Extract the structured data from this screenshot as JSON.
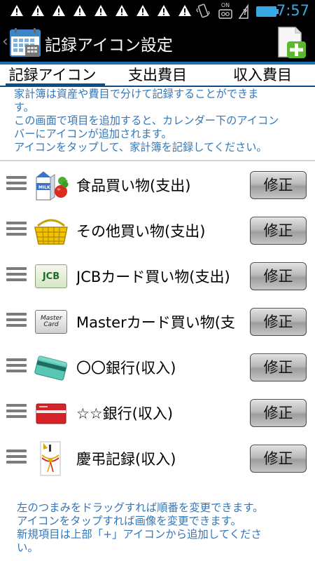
{
  "status_bar": {
    "time": "7:57",
    "notification_icons": [
      "warning-icon",
      "warning-icon",
      "warning-icon",
      "warning-icon",
      "warning-icon",
      "warning-icon",
      "warning-icon",
      "warning-icon",
      "warning-icon"
    ],
    "system_icons": [
      "vibrate-icon",
      "voicemail-icon",
      "no-signal-icon",
      "battery-icon"
    ],
    "voicemail_label": "ON",
    "time_color": "#39a9e6"
  },
  "action_bar": {
    "up_glyph": "‹",
    "title": "記録アイコン設定",
    "app_icon": "calendar-icon",
    "add_icon": "add-document-icon"
  },
  "tabs": [
    {
      "label": "記録アイコン",
      "selected": true
    },
    {
      "label": "支出費目",
      "selected": false
    },
    {
      "label": "収入費目",
      "selected": false
    }
  ],
  "intro": {
    "lines": [
      "家計簿は資産や費目で分けて記録することができま",
      "す。",
      "この画面で項目を追加すると、カレンダー下のアイコン",
      "バーにアイコンが追加されます。",
      "アイコンをタップして、家計簿を記録してください。"
    ]
  },
  "items": [
    {
      "label": "食品買い物(支出)",
      "icon": "groceries-icon",
      "button": "修正"
    },
    {
      "label": "その他買い物(支出)",
      "icon": "shopping-basket-icon",
      "button": "修正"
    },
    {
      "label": "JCBカード買い物(支出)",
      "icon": "jcb-card-icon",
      "icon_text": "JCB",
      "button": "修正"
    },
    {
      "label": "Masterカード買い物(支",
      "icon": "master-card-icon",
      "icon_text": "Master Card",
      "button": "修正"
    },
    {
      "label": "〇〇銀行(収入)",
      "icon": "bank-card-icon",
      "button": "修正"
    },
    {
      "label": "☆☆銀行(収入)",
      "icon": "red-card-icon",
      "button": "修正"
    },
    {
      "label": "慶弔記録(収入)",
      "icon": "gift-envelope-icon",
      "button": "修正"
    }
  ],
  "footer": {
    "lines": [
      "左のつまみをドラッグすれば順番を変更できます。",
      "アイコンをタップすれば画像を変更できます。",
      "新規項目は上部「+」アイコンから追加してくださ",
      "い。"
    ]
  },
  "colors": {
    "accent": "#1d6fb3",
    "tab_indicator": "#0b4f86",
    "help_text": "#3477b9"
  }
}
